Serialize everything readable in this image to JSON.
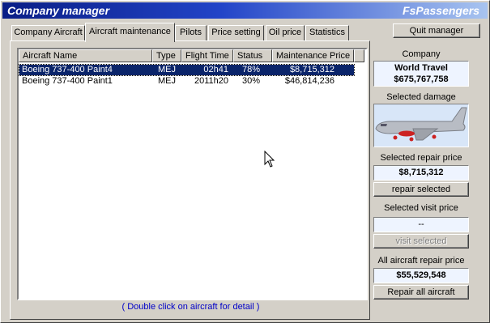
{
  "window": {
    "title": "Company manager",
    "brand": "FsPassengers"
  },
  "tabs": [
    {
      "label": "Company Aircraft"
    },
    {
      "label": "Aircraft maintenance"
    },
    {
      "label": "Pilots"
    },
    {
      "label": "Price setting"
    },
    {
      "label": "Oil price"
    },
    {
      "label": "Statistics"
    }
  ],
  "quit_label": "Quit manager",
  "list": {
    "columns": [
      "Aircraft Name",
      "Type",
      "Flight Time",
      "Status",
      "Maintenance Price"
    ],
    "rows": [
      [
        "Boeing 737-400 Paint4",
        "MEJ",
        "02h41",
        "78%",
        "$8,715,312"
      ],
      [
        "Boeing 737-400 Paint1",
        "MEJ",
        "2011h20",
        "30%",
        "$46,814,236"
      ]
    ],
    "hint": "( Double click on aircraft for detail )"
  },
  "side": {
    "company_label": "Company",
    "company_name": "World Travel",
    "company_money": "$675,767,758",
    "damage_label": "Selected damage",
    "repair_price_label": "Selected repair price",
    "repair_price": "$8,715,312",
    "repair_selected_button": "repair selected",
    "visit_price_label": "Selected visit price",
    "visit_price": "--",
    "visit_selected_button": "visit selected",
    "all_repair_label": "All aircraft repair price",
    "all_repair_price": "$55,529,548",
    "repair_all_button": "Repair all aircraft"
  },
  "colors": {
    "title_start": "#0a1e86",
    "title_end": "#a8c4f0",
    "selection": "#0a246a",
    "hint": "#0000c8",
    "damage_red": "#cc2222"
  }
}
